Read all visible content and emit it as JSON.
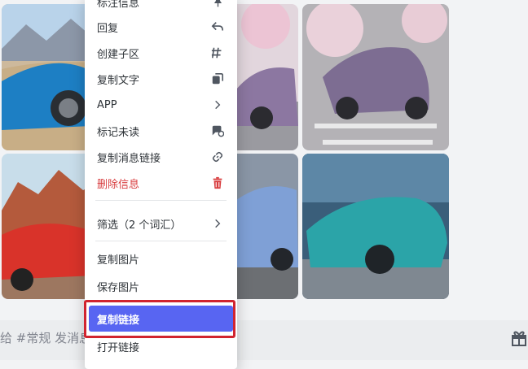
{
  "menu": {
    "items": [
      {
        "label": "标注信息",
        "icon": "pin-icon"
      },
      {
        "label": "回复",
        "icon": "reply-icon"
      },
      {
        "label": "创建子区",
        "icon": "thread-icon"
      },
      {
        "label": "复制文字",
        "icon": "copy-text-icon"
      },
      {
        "label": "APP",
        "icon": "chevron-right-icon"
      },
      {
        "label": "标记未读",
        "icon": "mark-unread-icon"
      },
      {
        "label": "复制消息链接",
        "icon": "link-icon"
      },
      {
        "label": "删除信息",
        "icon": "trash-icon",
        "danger": true
      },
      {
        "label": "筛选（2 个词汇）",
        "icon": "chevron-right-icon"
      },
      {
        "label": "复制图片"
      },
      {
        "label": "保存图片"
      },
      {
        "label": "复制链接",
        "highlighted": true
      },
      {
        "label": "打开链接"
      }
    ]
  },
  "composer": {
    "placeholder": "给 #常规 发消息"
  },
  "colors": {
    "accent": "#5865f2",
    "danger": "#d83c3e",
    "annotation_box": "#d1242f"
  }
}
